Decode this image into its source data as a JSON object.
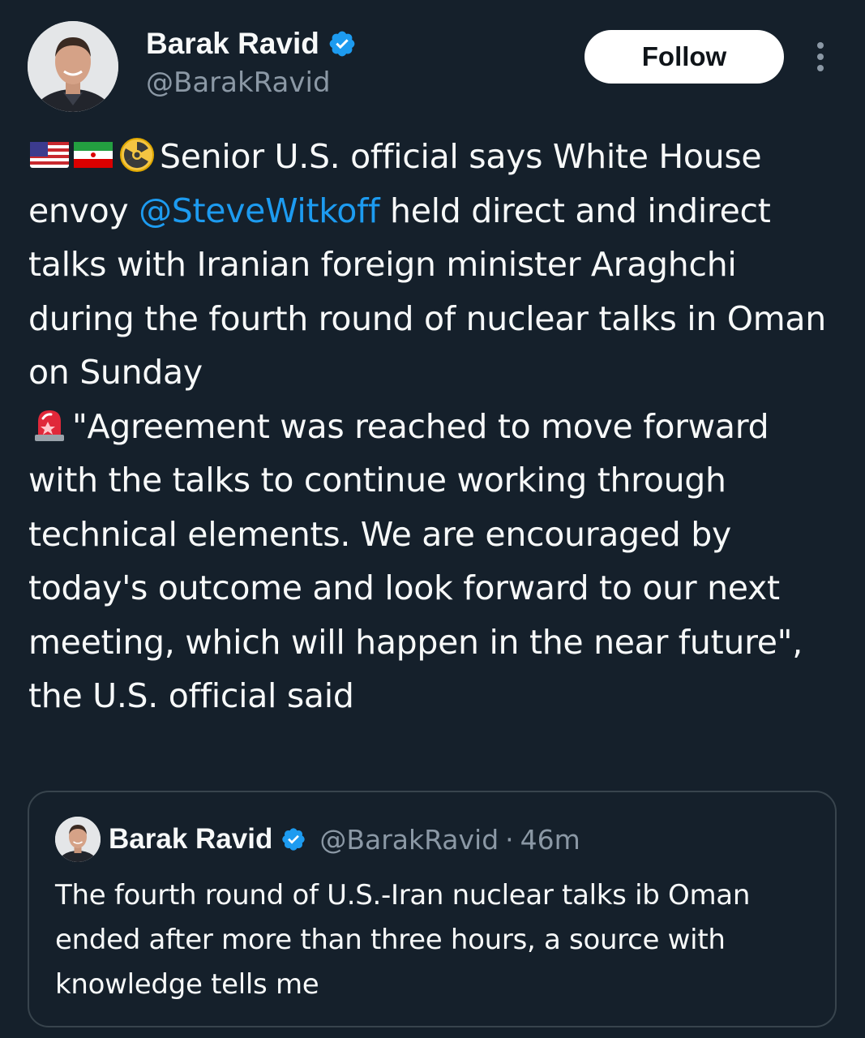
{
  "author": {
    "display_name": "Barak Ravid",
    "handle": "@BarakRavid",
    "verified": true
  },
  "actions": {
    "follow_label": "Follow"
  },
  "icons": {
    "verified": "verified-badge-icon",
    "more": "more-options-icon",
    "emoji_us_flag": "us-flag-emoji",
    "emoji_iran_flag": "iran-flag-emoji",
    "emoji_radioactive": "radioactive-emoji",
    "emoji_siren": "police-light-emoji"
  },
  "colors": {
    "background": "#15202b",
    "text": "#f7f9f9",
    "secondary_text": "#8b98a5",
    "mention": "#1d9bf0",
    "verified": "#1d9bf0",
    "border": "#38444d"
  },
  "tweet": {
    "text_part1": "Senior U.S. official says White House envoy ",
    "mention": "@SteveWitkoff",
    "text_part2": " held direct and indirect talks with Iranian foreign minister Araghchi during the fourth round of nuclear talks in Oman on Sunday",
    "text_part3": "\"Agreement was reached to move forward with the talks to continue working through technical elements. We are encouraged by today's outcome and look forward to our next meeting, which will happen in the near future\", the U.S. official said"
  },
  "quoted_tweet": {
    "display_name": "Barak Ravid",
    "handle": "@BarakRavid",
    "separator": "·",
    "time": "46m",
    "text": "The fourth round of U.S.-Iran nuclear talks ib Oman ended after more than three hours, a source with knowledge tells me"
  }
}
